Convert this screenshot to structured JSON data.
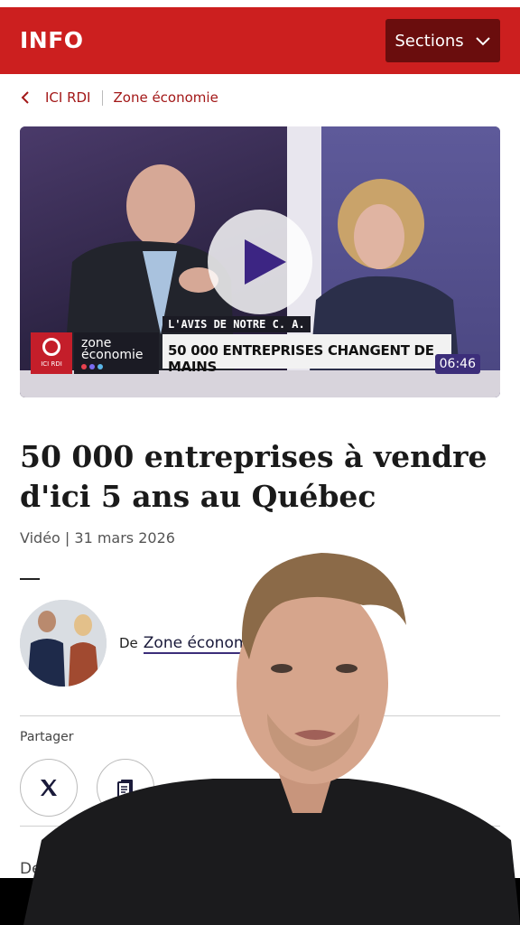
{
  "header": {
    "brand": "INFO",
    "sections_label": "Sections",
    "bg_color": "#cc1f1f"
  },
  "breadcrumb": {
    "items": [
      "ICI RDI",
      "Zone économie"
    ]
  },
  "video": {
    "duration": "06:46",
    "show_name_line1": "zone",
    "show_name_line2": "économie",
    "network_label": "ICI RDI",
    "tag": "L'AVIS DE NOTRE C. A.",
    "headline": "50 000 ENTREPRISES CHANGENT DE MAINS"
  },
  "article": {
    "title": "50 000 entreprises à vendre d'ici 5 ans au Québec",
    "meta": "Vidéo | 31 mars 2026",
    "author_prefix": "De",
    "author_link": "Zone économie",
    "share_label": "Partager",
    "lead_snippet": "Des diza"
  },
  "icons": {
    "back": "chevron-left-icon",
    "sections": "chevron-down-icon",
    "play": "play-icon",
    "share_x": "x-logo-icon",
    "share_copy": "copy-document-icon"
  }
}
